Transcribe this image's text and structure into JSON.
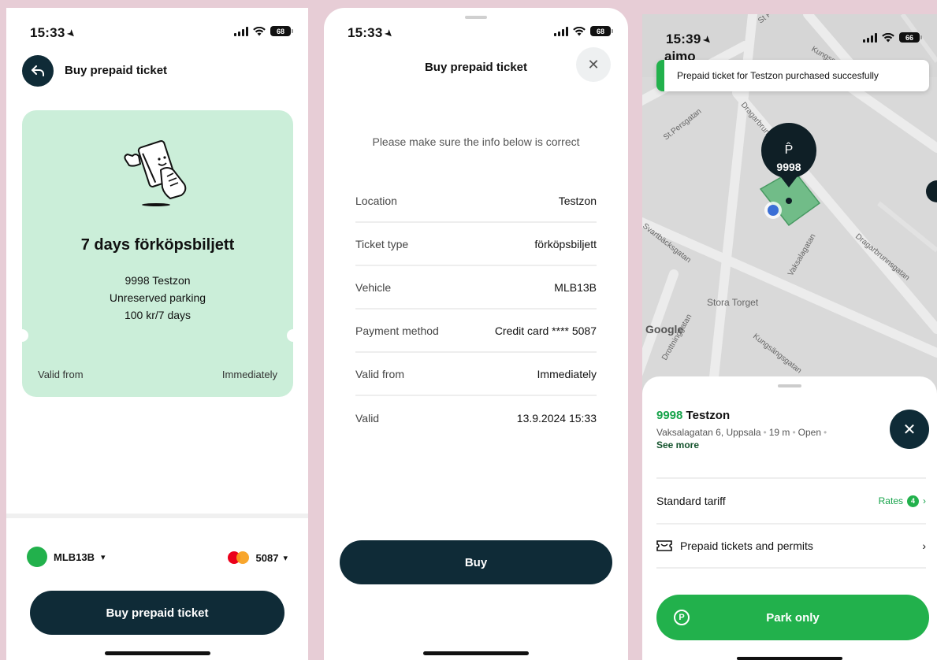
{
  "screen1": {
    "status": {
      "time": "15:33",
      "battery": "68"
    },
    "header_title": "Buy prepaid ticket",
    "ticket": {
      "name": "7 days förköpsbiljett",
      "zone": "9998 Testzon",
      "parking_type": "Unreserved parking",
      "price": "100 kr/7 days",
      "valid_from_label": "Valid from",
      "valid_from_value": "Immediately"
    },
    "vehicle": "MLB13B",
    "card_last4": "5087",
    "buy_button": "Buy prepaid ticket"
  },
  "screen2": {
    "status": {
      "time": "15:33",
      "battery": "68"
    },
    "title": "Buy prepaid ticket",
    "note": "Please make sure the info below is correct",
    "rows": [
      {
        "label": "Location",
        "value": "Testzon"
      },
      {
        "label": "Ticket type",
        "value": "förköpsbiljett"
      },
      {
        "label": "Vehicle",
        "value": "MLB13B"
      },
      {
        "label": "Payment method",
        "value": "Credit card **** 5087"
      },
      {
        "label": "Valid from",
        "value": "Immediately"
      },
      {
        "label": "Valid",
        "value": "13.9.2024 15:33"
      }
    ],
    "buy_button": "Buy"
  },
  "screen3": {
    "status": {
      "time": "15:39",
      "battery": "66"
    },
    "brand": "aimo",
    "toast": "Prepaid ticket for Testzon purchased succesfully",
    "map": {
      "pin_label": "9998",
      "pin_symbol": "P̂",
      "streets": [
        "Kungsgatan",
        "St Persgatan",
        "St.Persgatan",
        "Dragarbrunnsgatan",
        "Dragarbrunnsgatan",
        "Vaksalagatan",
        "Stora Torget",
        "Kungsängsgatan",
        "Drottninggatan",
        "Svartbäcksgatan"
      ],
      "google": "Google"
    },
    "location": {
      "number": "9998",
      "name": "Testzon",
      "address": "Vaksalagatan 6, Uppsala",
      "distance": "19 m",
      "status": "Open",
      "see_more": "See more"
    },
    "tariff_label": "Standard tariff",
    "rates_label": "Rates",
    "rates_count": "4",
    "prepaid_label": "Prepaid tickets and permits",
    "park_button": "Park only",
    "colors": {
      "brand_green": "#22b14c",
      "navy": "#0f2b37"
    }
  }
}
